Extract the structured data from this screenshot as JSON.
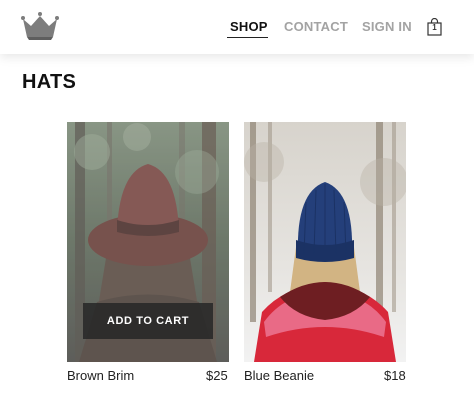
{
  "header": {
    "logo_icon": "crown-icon",
    "nav": {
      "shop": "SHOP",
      "contact": "CONTACT",
      "sign_in": "SIGN IN"
    },
    "cart_icon": "shopping-bag-icon",
    "cart_count": "1"
  },
  "page": {
    "title": "HATS"
  },
  "products": [
    {
      "name": "Brown Brim",
      "price": "$25",
      "add_to_cart_label": "ADD TO CART"
    },
    {
      "name": "Blue Beanie",
      "price": "$18"
    }
  ],
  "colors": {
    "nav_active": "#111111",
    "nav_inactive": "#a3a3a3",
    "button_bg": "#282828"
  }
}
